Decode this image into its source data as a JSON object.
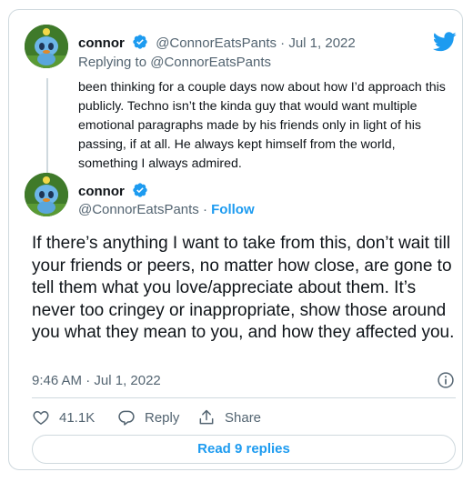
{
  "colors": {
    "accent": "#1d9bf0",
    "text": "#0f1419",
    "muted": "#536471",
    "border": "#cfd9de"
  },
  "parent_tweet": {
    "display_name": "connor",
    "handle": "@ConnorEatsPants",
    "separator": "·",
    "date": "Jul 1, 2022",
    "replying_to_label": "Replying to",
    "replying_to_handle": "@ConnorEatsPants",
    "text": "been thinking for a couple days now about how I’d approach this publicly. Techno isn’t the kinda guy that would want multiple emotional paragraphs made by his friends only in light of his passing, if at all. He always kept himself from the world, something I always admired."
  },
  "main_tweet": {
    "display_name": "connor",
    "handle": "@ConnorEatsPants",
    "separator": "·",
    "follow_label": "Follow",
    "text": "If there’s anything I want to take from this, don’t wait till your friends or peers, no matter how close, are gone to tell them what you love/appreciate about them. It’s never too cringey or inappropriate, show those around you what they mean to you, and how they affected you.",
    "time": "9:46 AM",
    "date": "Jul 1, 2022"
  },
  "actions": {
    "like_count": "41.1K",
    "reply_label": "Reply",
    "share_label": "Share"
  },
  "read_replies_label": "Read 9 replies",
  "icons": [
    "avatar-chao",
    "verified-badge-icon",
    "twitter-bird-icon",
    "info-icon",
    "heart-icon",
    "reply-icon",
    "share-icon"
  ]
}
